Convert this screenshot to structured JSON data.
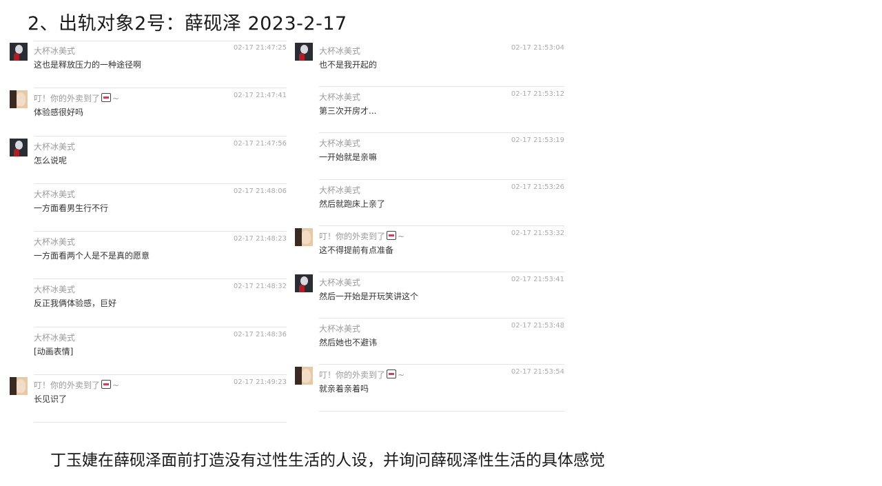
{
  "title": "2、出轨对象2号：薛砚泽 2023-2-17",
  "caption": "丁玉婕在薛砚泽面前打造没有过性生活的人设，并询问薛砚泽性生活的具体感觉",
  "chat_left": [
    {
      "sender": "大杯冰美式",
      "time": "02-17 21:47:25",
      "text": "这也是释放压力的一种途径啊"
    },
    {
      "sender": "叮！你的外卖到了",
      "suffix": "~",
      "time": "02-17 21:47:41",
      "text": "体验感很好吗"
    },
    {
      "sender": "大杯冰美式",
      "time": "02-17 21:47:56",
      "text": "怎么说呢"
    },
    {
      "sender": "大杯冰美式",
      "time": "02-17 21:48:06",
      "text": "一方面看男生行不行"
    },
    {
      "sender": "大杯冰美式",
      "time": "02-17 21:48:23",
      "text": "一方面看两个人是不是真的愿意"
    },
    {
      "sender": "大杯冰美式",
      "time": "02-17 21:48:32",
      "text": "反正我俩体验感，巨好"
    },
    {
      "sender": "大杯冰美式",
      "time": "02-17 21:48:36",
      "text": "[动画表情]"
    },
    {
      "sender": "叮！你的外卖到了",
      "suffix": "~",
      "time": "02-17 21:49:23",
      "text": "长见识了"
    }
  ],
  "chat_right": [
    {
      "sender": "大杯冰美式",
      "time": "02-17 21:53:04",
      "text": "也不是我开起的"
    },
    {
      "sender": "大杯冰美式",
      "time": "02-17 21:53:12",
      "text": "第三次开房才..."
    },
    {
      "sender": "大杯冰美式",
      "time": "02-17 21:53:19",
      "text": "一开始就是亲嘛"
    },
    {
      "sender": "大杯冰美式",
      "time": "02-17 21:53:26",
      "text": "然后就跑床上亲了"
    },
    {
      "sender": "叮！你的外卖到了",
      "suffix": "~",
      "time": "02-17 21:53:32",
      "text": "这不得提前有点准备"
    },
    {
      "sender": "大杯冰美式",
      "time": "02-17 21:53:41",
      "text": "然后一开始是开玩笑讲这个"
    },
    {
      "sender": "大杯冰美式",
      "time": "02-17 21:53:48",
      "text": "然后她也不避讳"
    },
    {
      "sender": "叮！你的外卖到了",
      "suffix": "~",
      "time": "02-17 21:53:54",
      "text": "就亲着亲着吗"
    }
  ]
}
